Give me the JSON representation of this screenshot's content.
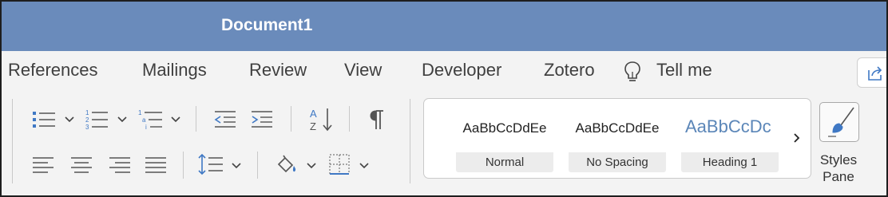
{
  "window": {
    "title": "Document1"
  },
  "tabs": [
    {
      "label": "References"
    },
    {
      "label": "Mailings"
    },
    {
      "label": "Review"
    },
    {
      "label": "View"
    },
    {
      "label": "Developer"
    },
    {
      "label": "Zotero"
    },
    {
      "label": "Tell me"
    }
  ],
  "ribbon": {
    "styles": [
      {
        "sample": "AaBbCcDdEe",
        "label": "Normal",
        "sample_color": "#222222"
      },
      {
        "sample": "AaBbCcDdEe",
        "label": "No Spacing",
        "sample_color": "#222222"
      },
      {
        "sample": "AaBbCcDc",
        "label": "Heading 1",
        "sample_color": "#5b86b8"
      }
    ],
    "more_arrow": "›",
    "styles_pane": {
      "line1": "Styles",
      "line2": "Pane"
    }
  },
  "colors": {
    "titlebar": "#6a8bbb",
    "accent_blue": "#3f78c4",
    "heading_blue": "#5b86b8"
  },
  "icons": [
    "bullets-icon",
    "numbering-icon",
    "multilevel-list-icon",
    "decrease-indent-icon",
    "increase-indent-icon",
    "sort-icon",
    "show-formatting-marks-icon",
    "align-left-icon",
    "center-icon",
    "align-right-icon",
    "justify-icon",
    "line-spacing-icon",
    "shading-icon",
    "borders-icon",
    "lightbulb-icon",
    "share-icon",
    "styles-pane-icon"
  ]
}
